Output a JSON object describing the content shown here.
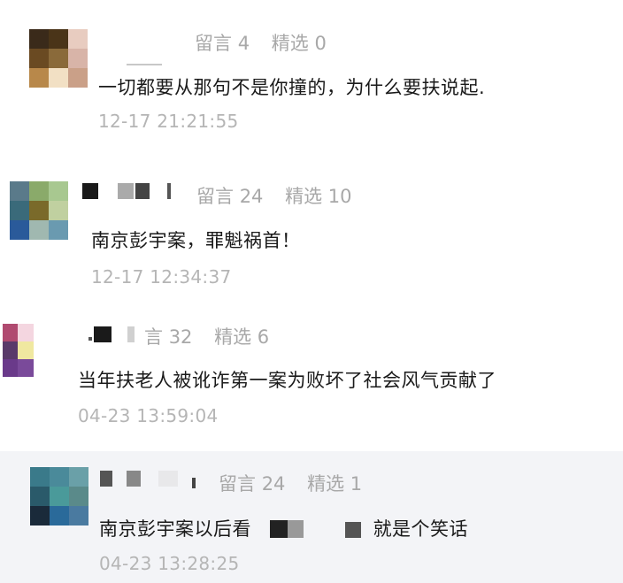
{
  "comments": [
    {
      "meta": {
        "replies_label": "留言",
        "replies_count": "4",
        "featured_label": "精选",
        "featured_count": "0"
      },
      "content": "一切都要从那句不是你撞的，为什么要扶说起.",
      "time": "12-17 21:21:55"
    },
    {
      "meta": {
        "replies_label": "留言",
        "replies_count": "24",
        "featured_label": "精选",
        "featured_count": "10"
      },
      "content": "南京彭宇案，罪魁祸首！",
      "time": "12-17 12:34:37"
    },
    {
      "meta": {
        "replies_label": "言",
        "replies_count": "32",
        "featured_label": "精选",
        "featured_count": "6"
      },
      "content": "当年扶老人被讹诈第一案为败坏了社会风气贡献了",
      "time": "04-23 13:59:04"
    },
    {
      "meta": {
        "replies_label": "留言",
        "replies_count": "24",
        "featured_label": "精选",
        "featured_count": "1"
      },
      "content_part1": "南京彭宇案以后看",
      "content_part2": "就是个笑话",
      "time": "04-23 13:28:25"
    }
  ],
  "colors": {
    "meta_text": "#a8a8a8",
    "time_text": "#b5b5b5",
    "highlight_bg": "#f3f4f7"
  },
  "icons": [
    "avatar-1",
    "avatar-2",
    "avatar-3",
    "avatar-4"
  ]
}
